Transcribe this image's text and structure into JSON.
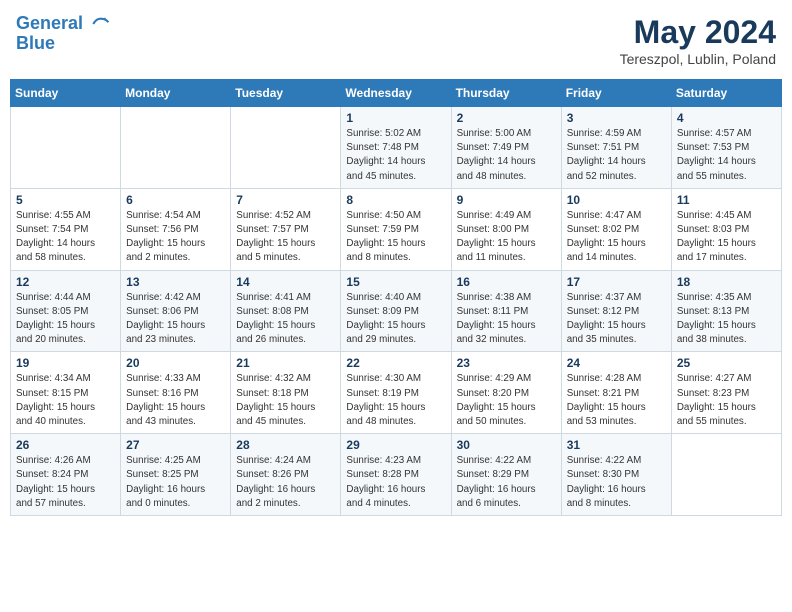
{
  "header": {
    "logo_line1": "General",
    "logo_line2": "Blue",
    "month": "May 2024",
    "location": "Tereszpol, Lublin, Poland"
  },
  "weekdays": [
    "Sunday",
    "Monday",
    "Tuesday",
    "Wednesday",
    "Thursday",
    "Friday",
    "Saturday"
  ],
  "weeks": [
    [
      {
        "day": "",
        "info": ""
      },
      {
        "day": "",
        "info": ""
      },
      {
        "day": "",
        "info": ""
      },
      {
        "day": "1",
        "info": "Sunrise: 5:02 AM\nSunset: 7:48 PM\nDaylight: 14 hours\nand 45 minutes."
      },
      {
        "day": "2",
        "info": "Sunrise: 5:00 AM\nSunset: 7:49 PM\nDaylight: 14 hours\nand 48 minutes."
      },
      {
        "day": "3",
        "info": "Sunrise: 4:59 AM\nSunset: 7:51 PM\nDaylight: 14 hours\nand 52 minutes."
      },
      {
        "day": "4",
        "info": "Sunrise: 4:57 AM\nSunset: 7:53 PM\nDaylight: 14 hours\nand 55 minutes."
      }
    ],
    [
      {
        "day": "5",
        "info": "Sunrise: 4:55 AM\nSunset: 7:54 PM\nDaylight: 14 hours\nand 58 minutes."
      },
      {
        "day": "6",
        "info": "Sunrise: 4:54 AM\nSunset: 7:56 PM\nDaylight: 15 hours\nand 2 minutes."
      },
      {
        "day": "7",
        "info": "Sunrise: 4:52 AM\nSunset: 7:57 PM\nDaylight: 15 hours\nand 5 minutes."
      },
      {
        "day": "8",
        "info": "Sunrise: 4:50 AM\nSunset: 7:59 PM\nDaylight: 15 hours\nand 8 minutes."
      },
      {
        "day": "9",
        "info": "Sunrise: 4:49 AM\nSunset: 8:00 PM\nDaylight: 15 hours\nand 11 minutes."
      },
      {
        "day": "10",
        "info": "Sunrise: 4:47 AM\nSunset: 8:02 PM\nDaylight: 15 hours\nand 14 minutes."
      },
      {
        "day": "11",
        "info": "Sunrise: 4:45 AM\nSunset: 8:03 PM\nDaylight: 15 hours\nand 17 minutes."
      }
    ],
    [
      {
        "day": "12",
        "info": "Sunrise: 4:44 AM\nSunset: 8:05 PM\nDaylight: 15 hours\nand 20 minutes."
      },
      {
        "day": "13",
        "info": "Sunrise: 4:42 AM\nSunset: 8:06 PM\nDaylight: 15 hours\nand 23 minutes."
      },
      {
        "day": "14",
        "info": "Sunrise: 4:41 AM\nSunset: 8:08 PM\nDaylight: 15 hours\nand 26 minutes."
      },
      {
        "day": "15",
        "info": "Sunrise: 4:40 AM\nSunset: 8:09 PM\nDaylight: 15 hours\nand 29 minutes."
      },
      {
        "day": "16",
        "info": "Sunrise: 4:38 AM\nSunset: 8:11 PM\nDaylight: 15 hours\nand 32 minutes."
      },
      {
        "day": "17",
        "info": "Sunrise: 4:37 AM\nSunset: 8:12 PM\nDaylight: 15 hours\nand 35 minutes."
      },
      {
        "day": "18",
        "info": "Sunrise: 4:35 AM\nSunset: 8:13 PM\nDaylight: 15 hours\nand 38 minutes."
      }
    ],
    [
      {
        "day": "19",
        "info": "Sunrise: 4:34 AM\nSunset: 8:15 PM\nDaylight: 15 hours\nand 40 minutes."
      },
      {
        "day": "20",
        "info": "Sunrise: 4:33 AM\nSunset: 8:16 PM\nDaylight: 15 hours\nand 43 minutes."
      },
      {
        "day": "21",
        "info": "Sunrise: 4:32 AM\nSunset: 8:18 PM\nDaylight: 15 hours\nand 45 minutes."
      },
      {
        "day": "22",
        "info": "Sunrise: 4:30 AM\nSunset: 8:19 PM\nDaylight: 15 hours\nand 48 minutes."
      },
      {
        "day": "23",
        "info": "Sunrise: 4:29 AM\nSunset: 8:20 PM\nDaylight: 15 hours\nand 50 minutes."
      },
      {
        "day": "24",
        "info": "Sunrise: 4:28 AM\nSunset: 8:21 PM\nDaylight: 15 hours\nand 53 minutes."
      },
      {
        "day": "25",
        "info": "Sunrise: 4:27 AM\nSunset: 8:23 PM\nDaylight: 15 hours\nand 55 minutes."
      }
    ],
    [
      {
        "day": "26",
        "info": "Sunrise: 4:26 AM\nSunset: 8:24 PM\nDaylight: 15 hours\nand 57 minutes."
      },
      {
        "day": "27",
        "info": "Sunrise: 4:25 AM\nSunset: 8:25 PM\nDaylight: 16 hours\nand 0 minutes."
      },
      {
        "day": "28",
        "info": "Sunrise: 4:24 AM\nSunset: 8:26 PM\nDaylight: 16 hours\nand 2 minutes."
      },
      {
        "day": "29",
        "info": "Sunrise: 4:23 AM\nSunset: 8:28 PM\nDaylight: 16 hours\nand 4 minutes."
      },
      {
        "day": "30",
        "info": "Sunrise: 4:22 AM\nSunset: 8:29 PM\nDaylight: 16 hours\nand 6 minutes."
      },
      {
        "day": "31",
        "info": "Sunrise: 4:22 AM\nSunset: 8:30 PM\nDaylight: 16 hours\nand 8 minutes."
      },
      {
        "day": "",
        "info": ""
      }
    ]
  ]
}
